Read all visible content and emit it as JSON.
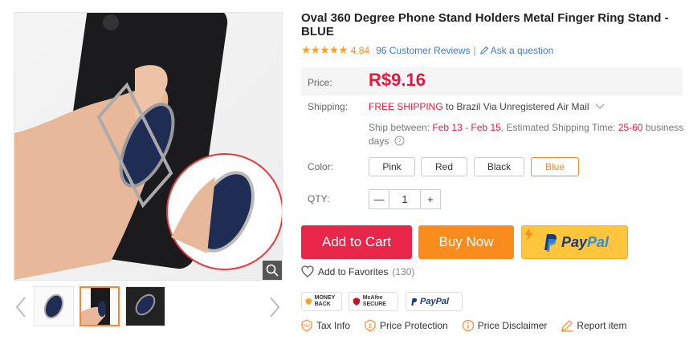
{
  "product": {
    "title": "Oval 360 Degree Phone Stand Holders Metal Finger Ring Stand - BLUE",
    "rating": "4.84",
    "reviews": "96 Customer Reviews",
    "separator": "|",
    "ask": "Ask a question"
  },
  "price": {
    "label": "Price:",
    "value": "R$9.16"
  },
  "shipping": {
    "label": "Shipping:",
    "free": "FREE SHIPPING",
    "rest": "to Brazil Via Unregistered Air Mail",
    "between_label": "Ship between:",
    "dates": "Feb 13 - Feb 15",
    "est_label": ", Estimated Shipping Time:",
    "est_days": "25-60",
    "business": "business",
    "days": "days"
  },
  "color": {
    "label": "Color:",
    "options": [
      "Pink",
      "Red",
      "Black",
      "Blue"
    ],
    "selected": "Blue"
  },
  "qty": {
    "label": "QTY:",
    "minus": "—",
    "value": "1",
    "plus": "+"
  },
  "buttons": {
    "cart": "Add to Cart",
    "buy": "Buy Now",
    "paypal_pay": "Pay",
    "paypal_pal": "Pal"
  },
  "favorites": {
    "label": "Add to Favorites",
    "count": "(130)"
  },
  "badges": {
    "money_back": "MONEY BACK",
    "mcafee": "McAfee SECURE",
    "paypal": "PayPal"
  },
  "info_links": [
    "Tax Info",
    "Price Protection",
    "Price Disclaimer",
    "Report item"
  ],
  "colors": {
    "accent_red": "#e4193d",
    "orange": "#fa8c1e",
    "paypal_yellow": "#ffc53d",
    "link_blue": "#3a7bd5"
  }
}
